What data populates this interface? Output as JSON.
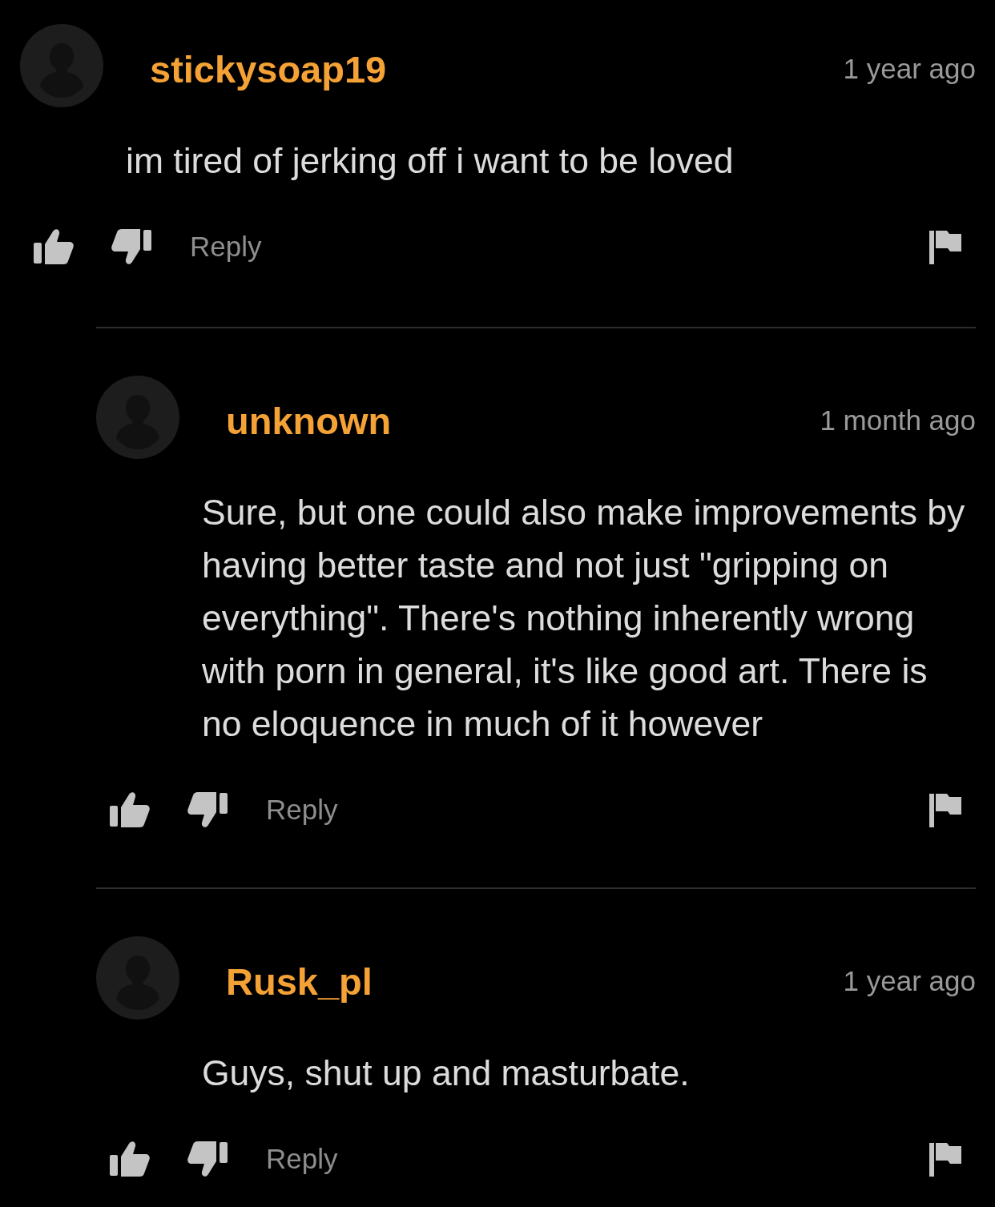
{
  "comments": [
    {
      "username": "stickysoap19",
      "time": "1 year ago",
      "text": "im tired of jerking off i want to be loved",
      "reply_label": "Reply",
      "children": [
        {
          "username": "unknown",
          "time": "1 month ago",
          "text": "Sure, but one could also make improvements by having better taste and not just \"gripping on everything\". There's nothing inherently wrong with porn in general, it's like good art. There is no eloquence in much of it however",
          "reply_label": "Reply"
        },
        {
          "username": "Rusk_pl",
          "time": "1 year ago",
          "text": "Guys, shut up and masturbate.",
          "reply_label": "Reply"
        }
      ]
    }
  ]
}
